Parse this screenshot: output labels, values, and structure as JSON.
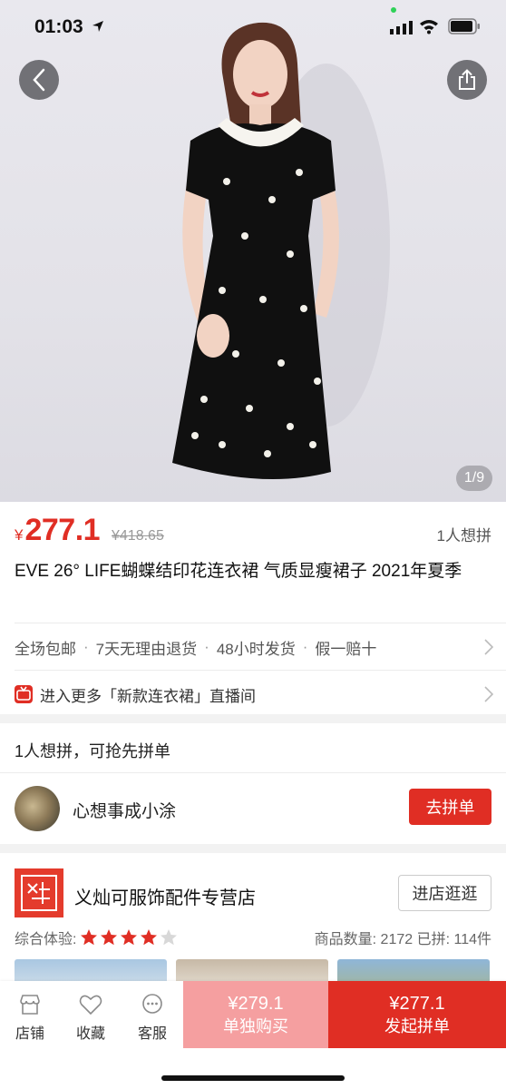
{
  "status_bar": {
    "time": "01:03"
  },
  "hero": {
    "pager": "1/9"
  },
  "product": {
    "currency": "¥",
    "price": "277.1",
    "original_price": "¥418.65",
    "want_count": "1人想拼",
    "title": "EVE 26° LIFE蝴蝶结印花连衣裙 气质显瘦裙子 2021年夏季",
    "services": [
      "全场包邮",
      "7天无理由退货",
      "48小时发货",
      "假一赔十"
    ],
    "service_separator": "·",
    "live_room": "进入更多「新款连衣裙」直播间"
  },
  "group_buy": {
    "title": "1人想拼，可抢先拼单",
    "member_name": "心想事成小涂",
    "join_button": "去拼单"
  },
  "store": {
    "logo_text": "义灿可",
    "name": "义灿可服饰配件专营店",
    "visit_button": "进店逛逛",
    "rating_label": "综合体验:",
    "rating_stars": 4,
    "rating_max": 5,
    "stats": "商品数量: 2172  已拼: 114件"
  },
  "bottom_bar": {
    "tabs": [
      {
        "label": "店铺",
        "icon": "store-icon"
      },
      {
        "label": "收藏",
        "icon": "heart-icon"
      },
      {
        "label": "客服",
        "icon": "chat-icon"
      }
    ],
    "solo_price": "¥279.1",
    "solo_label": "单独购买",
    "group_price": "¥277.1",
    "group_label": "发起拼单"
  },
  "colors": {
    "accent": "#e02e24",
    "solo_button": "#f59fa0"
  }
}
